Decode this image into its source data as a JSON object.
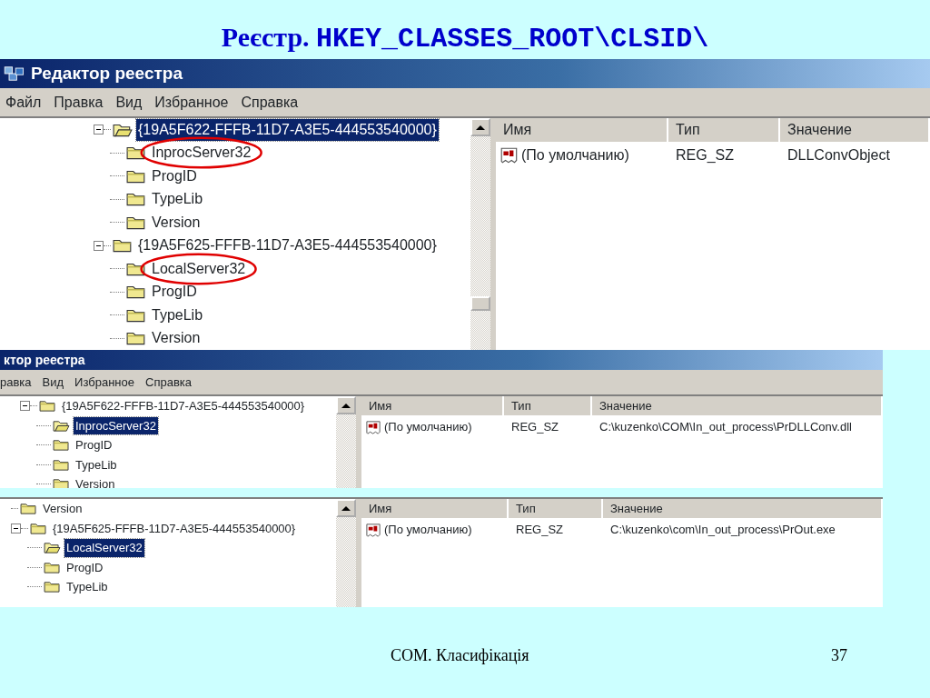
{
  "slide": {
    "title_prefix": "Реєстр.",
    "title_path": "HKEY_CLASSES_ROOT\\CLSID\\"
  },
  "screenshots": [
    {
      "title": "Редактор реестра",
      "menu": [
        "Файл",
        "Правка",
        "Вид",
        "Избранное",
        "Справка"
      ],
      "tree": [
        {
          "label": "{19A5F622-FFFB-11D7-A3E5-444553540000}",
          "selected": true,
          "expanded": true,
          "circled": false,
          "children": [
            {
              "label": "InprocServer32",
              "selected": false,
              "circled": true
            },
            {
              "label": "ProgID",
              "selected": false,
              "circled": false
            },
            {
              "label": "TypeLib",
              "selected": false,
              "circled": false
            },
            {
              "label": "Version",
              "selected": false,
              "circled": false
            }
          ]
        },
        {
          "label": "{19A5F625-FFFB-11D7-A3E5-444553540000}",
          "selected": false,
          "expanded": true,
          "circled": false,
          "children": [
            {
              "label": "LocalServer32",
              "selected": false,
              "circled": true
            },
            {
              "label": "ProgID",
              "selected": false,
              "circled": false
            },
            {
              "label": "TypeLib",
              "selected": false,
              "circled": false
            },
            {
              "label": "Version",
              "selected": false,
              "circled": false
            }
          ]
        }
      ],
      "list": {
        "columns": [
          "Имя",
          "Тип",
          "Значение"
        ],
        "rows": [
          {
            "name": "(По умолчанию)",
            "type": "REG_SZ",
            "value": "DLLConvObject"
          }
        ]
      }
    },
    {
      "title": "ктор реестра",
      "menu": [
        "равка",
        "Вид",
        "Избранное",
        "Справка"
      ],
      "tree": [
        {
          "label": "{19A5F622-FFFB-11D7-A3E5-444553540000}",
          "selected": false,
          "expanded": true,
          "circled": false,
          "children": [
            {
              "label": "InprocServer32",
              "selected": true,
              "circled": false
            },
            {
              "label": "ProgID",
              "selected": false,
              "circled": false
            },
            {
              "label": "TypeLib",
              "selected": false,
              "circled": false
            },
            {
              "label": "Version",
              "selected": false,
              "circled": false
            }
          ]
        }
      ],
      "list": {
        "columns": [
          "Имя",
          "Тип",
          "Значение"
        ],
        "rows": [
          {
            "name": "(По умолчанию)",
            "type": "REG_SZ",
            "value": "C:\\kuzenko\\COM\\In_out_process\\PrDLLConv.dll"
          }
        ]
      }
    },
    {
      "tree": [
        {
          "label": "Version",
          "selected": false,
          "circled": false
        },
        {
          "label": "{19A5F625-FFFB-11D7-A3E5-444553540000}",
          "selected": false,
          "expanded": true,
          "circled": false,
          "children": [
            {
              "label": "LocalServer32",
              "selected": true,
              "circled": false
            },
            {
              "label": "ProgID",
              "selected": false,
              "circled": false
            },
            {
              "label": "TypeLib",
              "selected": false,
              "circled": false
            }
          ]
        }
      ],
      "list": {
        "columns": [
          "Имя",
          "Тип",
          "Значение"
        ],
        "rows": [
          {
            "name": "(По умолчанию)",
            "type": "REG_SZ",
            "value": "C:\\kuzenko\\com\\In_out_process\\PrOut.exe"
          }
        ]
      }
    }
  ],
  "footer": {
    "caption": "COM. Класифікація",
    "page": "37"
  }
}
